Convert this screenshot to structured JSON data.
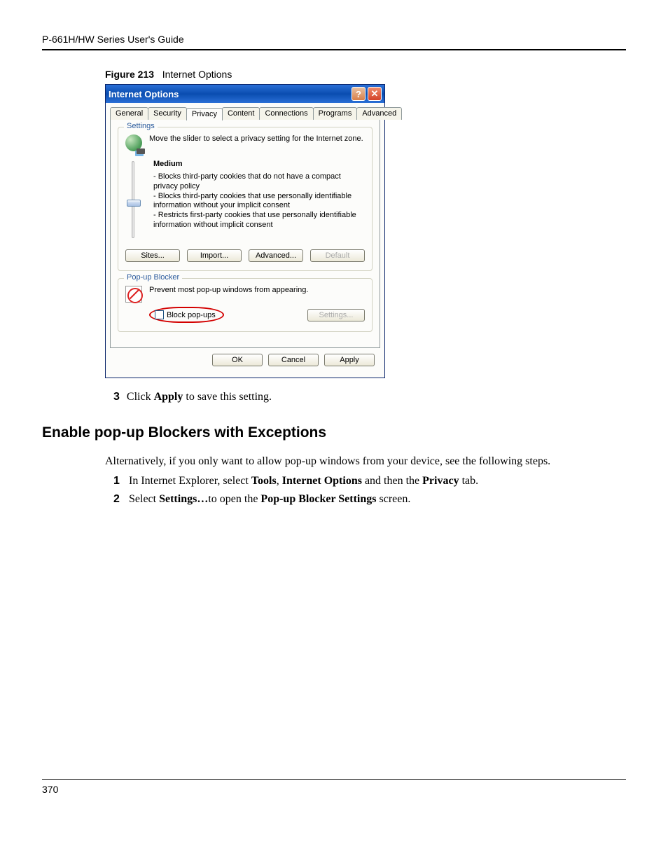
{
  "header": {
    "guide": "P-661H/HW Series User's Guide"
  },
  "figure": {
    "label": "Figure 213",
    "title": "Internet Options"
  },
  "dialog": {
    "title": "Internet Options",
    "help_glyph": "?",
    "close_glyph": "✕",
    "tabs": {
      "general": "General",
      "security": "Security",
      "privacy": "Privacy",
      "content": "Content",
      "connections": "Connections",
      "programs": "Programs",
      "advanced": "Advanced"
    },
    "settings_group": {
      "title": "Settings",
      "intro": "Move the slider to select a privacy setting for the Internet zone.",
      "level": "Medium",
      "bullets": {
        "b1": "- Blocks third-party cookies that do not have a compact privacy policy",
        "b2": "- Blocks third-party cookies that use personally identifiable information without your implicit consent",
        "b3": "- Restricts first-party cookies that use personally identifiable information without implicit consent"
      },
      "buttons": {
        "sites": "Sites...",
        "import": "Import...",
        "advanced": "Advanced...",
        "default": "Default"
      }
    },
    "popup_group": {
      "title": "Pop-up Blocker",
      "intro": "Prevent most pop-up windows from appearing.",
      "checkbox": "Block pop-ups",
      "settings_btn": "Settings..."
    },
    "footer": {
      "ok": "OK",
      "cancel": "Cancel",
      "apply": "Apply"
    }
  },
  "body": {
    "step3_num": "3",
    "step3_a": "Click ",
    "step3_b": "Apply",
    "step3_c": " to save this setting.",
    "heading": "Enable pop-up Blockers with Exceptions",
    "para": "Alternatively, if you only want to allow pop-up windows from your device, see the following steps.",
    "step1_num": "1",
    "step1_a": "In Internet Explorer, select ",
    "step1_b": "Tools",
    "step1_c": ", ",
    "step1_d": "Internet Options",
    "step1_e": " and then the ",
    "step1_f": "Privacy",
    "step1_g": " tab.",
    "step2_num": "2",
    "step2_a": "Select ",
    "step2_b": "Settings…",
    "step2_c": "to open the ",
    "step2_d": "Pop-up Blocker Settings",
    "step2_e": " screen."
  },
  "footer_page": "370"
}
